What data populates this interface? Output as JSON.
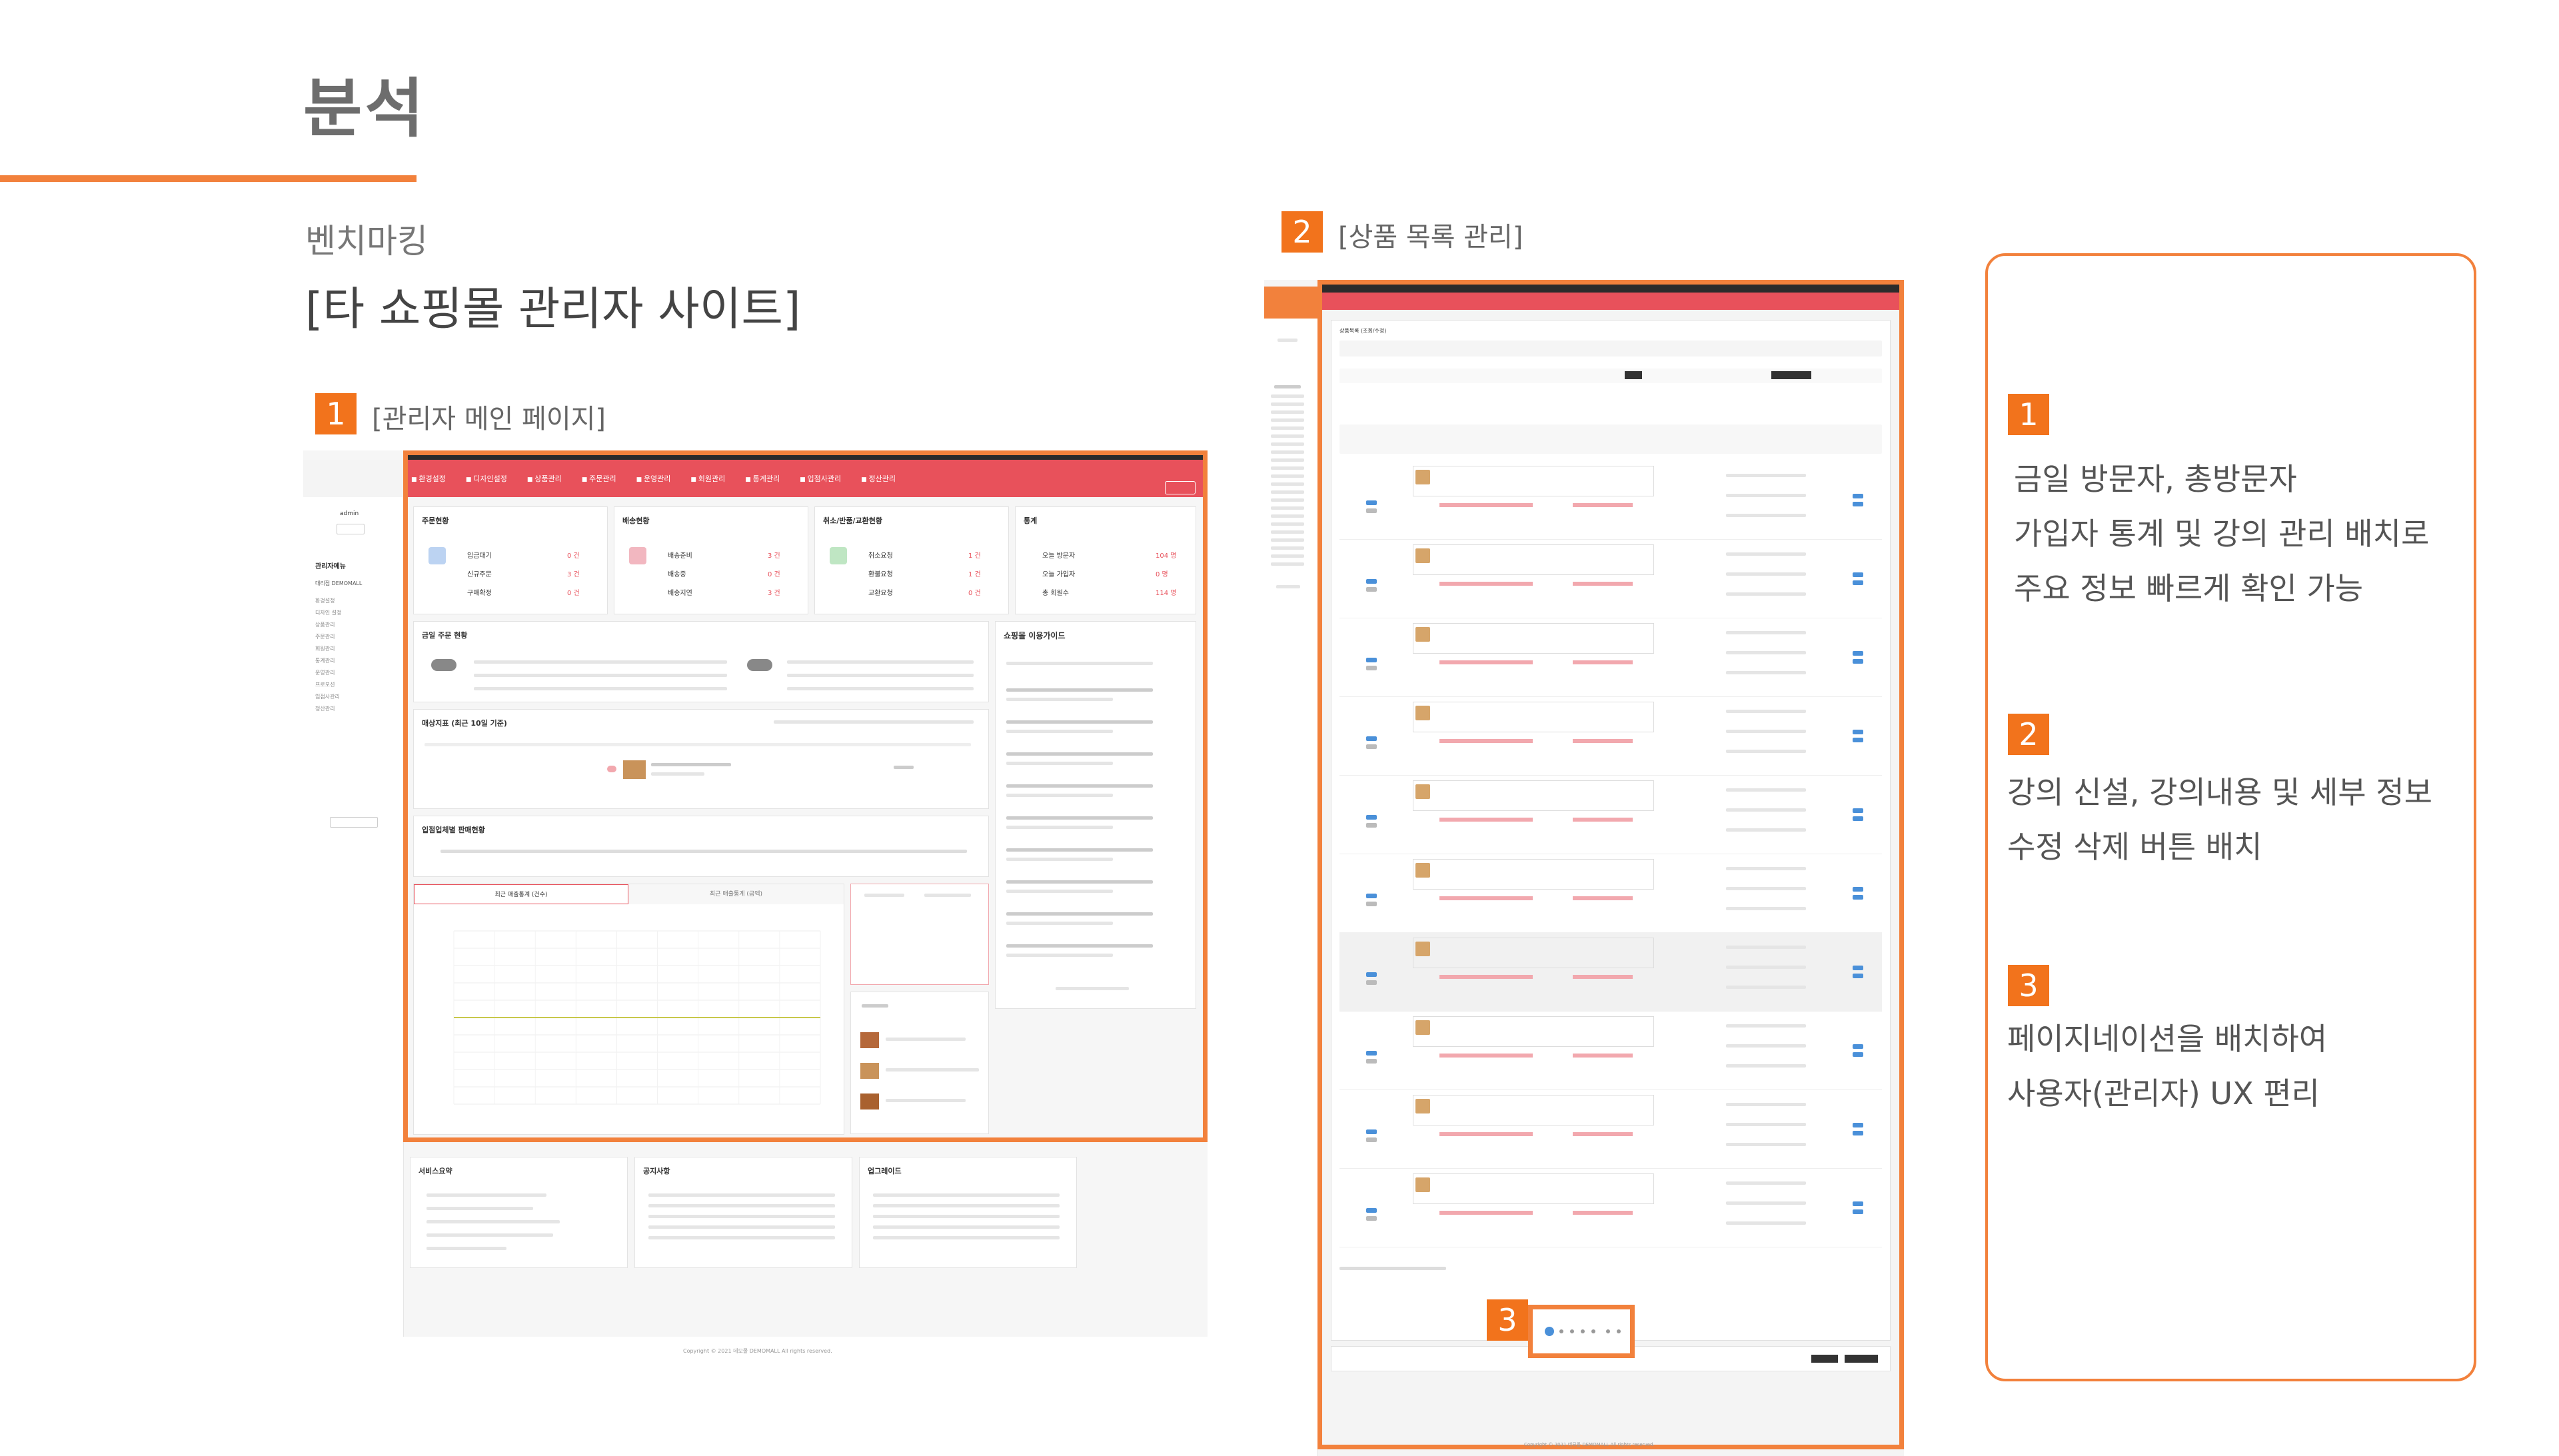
{
  "slide": {
    "title": "분석",
    "section_label": "벤치마킹",
    "section_subtitle": "[타 쇼핑몰 관리자 사이트]"
  },
  "captions": [
    {
      "number": "1",
      "label": "[관리자 메인 페이지]"
    },
    {
      "number": "2",
      "label": "[상품 목록 관리]"
    },
    {
      "number": "3",
      "label": ""
    }
  ],
  "descriptions": [
    {
      "number": "1",
      "lines": [
        "금일 방문자, 총방문자",
        "가입자 통계 및 강의 관리 배치로",
        "주요 정보 빠르게 확인 가능"
      ]
    },
    {
      "number": "2",
      "lines": [
        "강의 신설, 강의내용 및 세부 정보",
        "수정 삭제 버튼 배치"
      ]
    },
    {
      "number": "3",
      "lines": [
        "페이지네이션을 배치하여",
        "사용자(관리자) UX 편리"
      ]
    }
  ],
  "dashboard": {
    "sidebar": {
      "user": "admin",
      "section": "관리자메뉴",
      "items": [
        "대리점 DEMOMALL",
        "환경설정",
        "디자인 설정",
        "상품관리",
        "주문관리",
        "회원관리",
        "통계관리",
        "운영관리",
        "프로모션",
        "입점사관리",
        "정산관리"
      ]
    },
    "nav": [
      "환경설정",
      "디자인설정",
      "상품관리",
      "주문관리",
      "운영관리",
      "회원관리",
      "통계관리",
      "입점사관리",
      "정산관리"
    ],
    "cards": {
      "order_status": {
        "title": "주문현황",
        "rows": [
          {
            "label": "입금대기",
            "value": "0 건"
          },
          {
            "label": "신규주문",
            "value": "3 건"
          },
          {
            "label": "구매확정",
            "value": "0 건"
          }
        ]
      },
      "delivery_status": {
        "title": "배송현황",
        "rows": [
          {
            "label": "배송준비",
            "value": "3 건"
          },
          {
            "label": "배송중",
            "value": "0 건"
          },
          {
            "label": "배송지연",
            "value": "3 건"
          }
        ]
      },
      "cancel_status": {
        "title": "취소/반품/교환현황",
        "rows": [
          {
            "label": "취소요청",
            "value": "1 건"
          },
          {
            "label": "환불요청",
            "value": "1 건"
          },
          {
            "label": "교환요청",
            "value": "0 건"
          }
        ]
      },
      "stats": {
        "title": "통계",
        "rows": [
          {
            "label": "오늘 방문자",
            "value": "104 명"
          },
          {
            "label": "오늘 가입자",
            "value": "0 명"
          },
          {
            "label": "총 회원수",
            "value": "114 명"
          }
        ]
      },
      "guide": {
        "title": "쇼핑몰 이용가이드"
      },
      "weekly": {
        "title": "금일 주문 현황"
      },
      "sales": {
        "title": "매상지표 (최근 10일 기준)"
      },
      "vendor": {
        "title": "입점업체별 판매현황"
      },
      "chart_tab_a": "최근 매출통계 (건수)",
      "chart_tab_b": "최근 매출통계 (금액)",
      "service": {
        "title": "서비스요약"
      },
      "notice": {
        "title": "공지사항"
      },
      "update": {
        "title": "업그레이드"
      }
    },
    "footer": "Copyright © 2021 데모몰 DEMOMALL All rights reserved."
  },
  "product_list": {
    "title": "상품목록 (조회/수정)",
    "footer": "Copyright © 2021 데모몰 DEMOMALL All rights reserved."
  },
  "chart_data": {
    "type": "line",
    "title": "",
    "series": [
      {
        "values": [
          1,
          1,
          1,
          1,
          1,
          1,
          1,
          1,
          1,
          1
        ]
      }
    ],
    "ylim": [
      0,
      2
    ],
    "grid": true
  },
  "colors": {
    "accent": "#f2813c",
    "badge": "#f2731c",
    "nav_red": "#e8515b"
  }
}
